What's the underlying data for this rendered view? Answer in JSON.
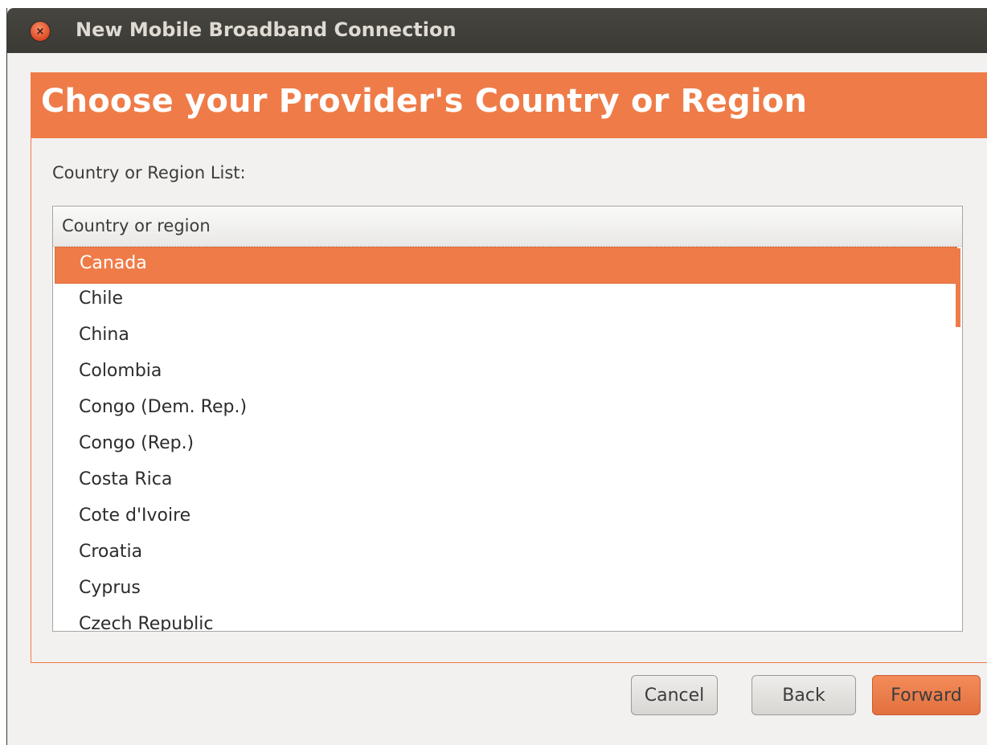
{
  "window": {
    "title": "New Mobile Broadband Connection",
    "close_glyph": "×"
  },
  "banner": {
    "heading": "Choose your Provider's Country or Region"
  },
  "list": {
    "label": "Country or Region List:",
    "column_header": "Country or region",
    "items": [
      "Canada",
      "Chile",
      "China",
      "Colombia",
      "Congo (Dem. Rep.)",
      "Congo (Rep.)",
      "Costa Rica",
      "Cote d'Ivoire",
      "Croatia",
      "Cyprus",
      "Czech Republic"
    ],
    "selected": "Canada"
  },
  "buttons": {
    "cancel": "Cancel",
    "back": "Back",
    "forward": "Forward"
  },
  "colors": {
    "accent": "#ef7c48",
    "titlebar": "#3b3a35",
    "window_bg": "#f2f1f0"
  }
}
